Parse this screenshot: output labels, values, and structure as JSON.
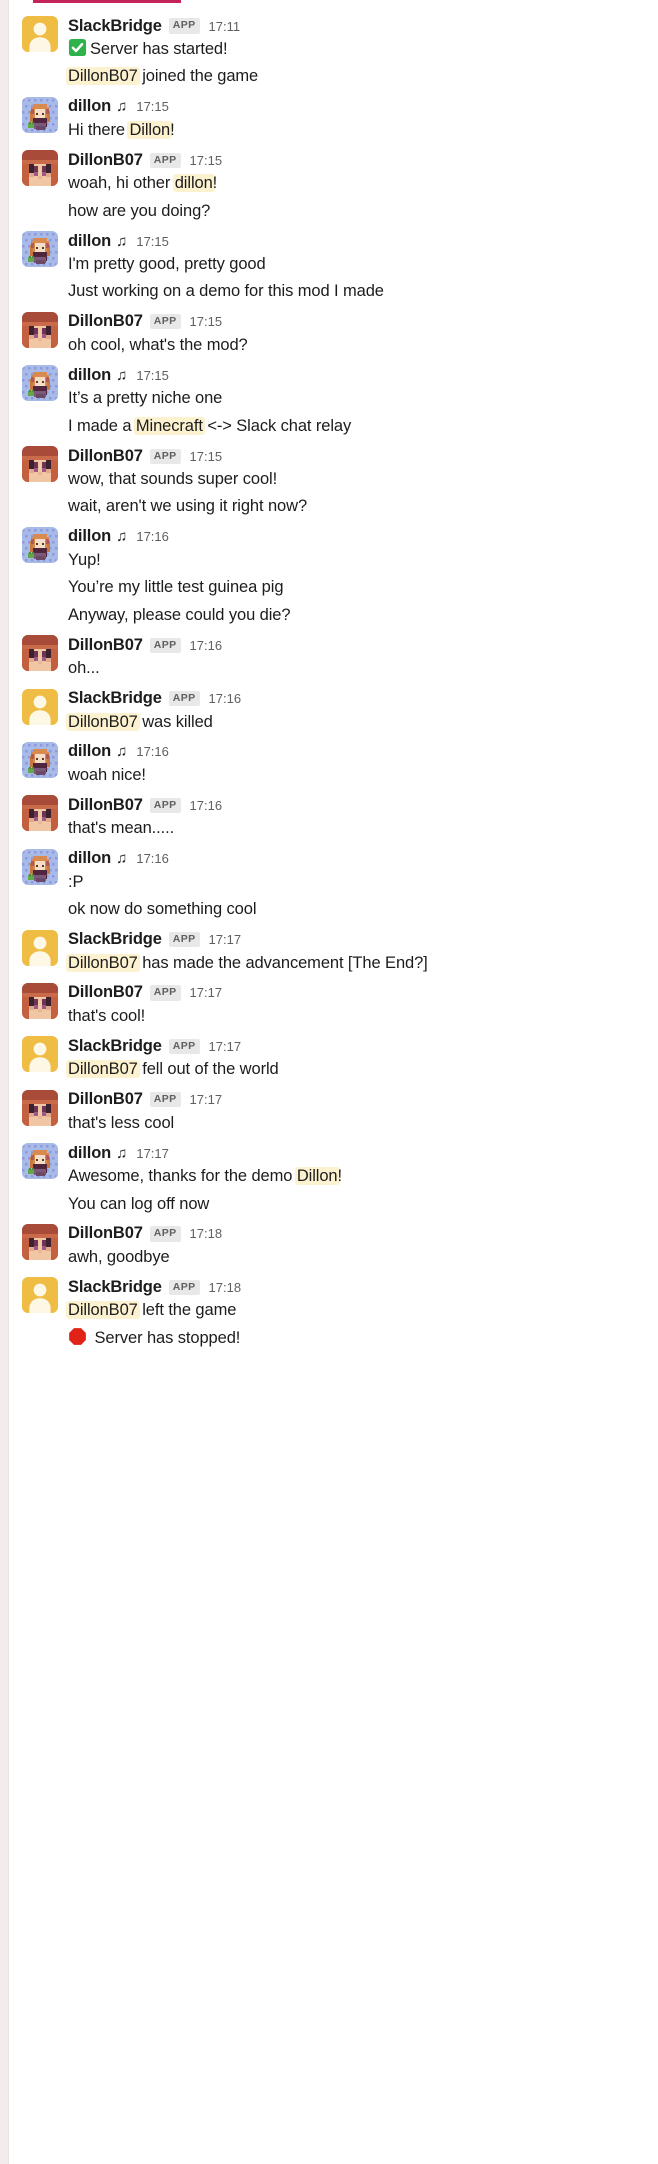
{
  "accent_color": "#c4235c",
  "mention_highlight_color": "#fdf2d0",
  "app_badge_label": "APP",
  "users": {
    "slackbridge": {
      "name": "SlackBridge",
      "is_app": true,
      "avatar": "yellow-person-avatar"
    },
    "dillon": {
      "name": "dillon",
      "is_app": false,
      "status_emoji": "musical-note",
      "avatar": "pixel-girl-avatar"
    },
    "dillonb07": {
      "name": "DillonB07",
      "is_app": true,
      "avatar": "minecraft-skin-avatar"
    }
  },
  "messages": [
    {
      "user": "slackbridge",
      "name": "SlackBridge",
      "badge": "APP",
      "time": "17:11",
      "first": true,
      "lines": [
        {
          "emoji": "white-check-mark",
          "text": "Server has started!"
        },
        {
          "mention": "DillonB07",
          "text": " joined the game"
        }
      ]
    },
    {
      "user": "dillon",
      "name": "dillon",
      "badge": "",
      "time": "17:15",
      "first": true,
      "lines": [
        {
          "text": "Hi there ",
          "mention_after": "Dillon",
          "text_after": "!"
        }
      ]
    },
    {
      "user": "dillonb07",
      "name": "DillonB07",
      "badge": "APP",
      "time": "17:15",
      "first": true,
      "lines": [
        {
          "text": "woah, hi other ",
          "mention_after": "dillon",
          "text_after": "!"
        },
        {
          "text": "how are you doing?"
        }
      ]
    },
    {
      "user": "dillon",
      "name": "dillon",
      "badge": "",
      "time": "17:15",
      "first": true,
      "lines": [
        {
          "text": "I'm pretty good, pretty good"
        },
        {
          "text": "Just working on a demo for this mod I made"
        }
      ]
    },
    {
      "user": "dillonb07",
      "name": "DillonB07",
      "badge": "APP",
      "time": "17:15",
      "first": true,
      "lines": [
        {
          "text": "oh cool, what's the mod?"
        }
      ]
    },
    {
      "user": "dillon",
      "name": "dillon",
      "badge": "",
      "time": "17:15",
      "first": true,
      "lines": [
        {
          "text": "It’s a pretty niche one"
        },
        {
          "text": "I made a ",
          "mention_after": "Minecraft",
          "text_after": " <-> Slack chat relay"
        }
      ]
    },
    {
      "user": "dillonb07",
      "name": "DillonB07",
      "badge": "APP",
      "time": "17:15",
      "first": true,
      "lines": [
        {
          "text": "wow, that sounds super cool!"
        },
        {
          "text": "wait, aren't we using it right now?"
        }
      ]
    },
    {
      "user": "dillon",
      "name": "dillon",
      "badge": "",
      "time": "17:16",
      "first": true,
      "lines": [
        {
          "text": "Yup!"
        },
        {
          "text": "You’re my little test guinea pig"
        },
        {
          "text": "Anyway, please could you die?"
        }
      ]
    },
    {
      "user": "dillonb07",
      "name": "DillonB07",
      "badge": "APP",
      "time": "17:16",
      "first": true,
      "lines": [
        {
          "text": "oh..."
        }
      ]
    },
    {
      "user": "slackbridge",
      "name": "SlackBridge",
      "badge": "APP",
      "time": "17:16",
      "first": true,
      "lines": [
        {
          "mention": "DillonB07",
          "text": " was killed"
        }
      ]
    },
    {
      "user": "dillon",
      "name": "dillon",
      "badge": "",
      "time": "17:16",
      "first": true,
      "lines": [
        {
          "text": "woah nice!"
        }
      ]
    },
    {
      "user": "dillonb07",
      "name": "DillonB07",
      "badge": "APP",
      "time": "17:16",
      "first": true,
      "lines": [
        {
          "text": "that's mean....."
        }
      ]
    },
    {
      "user": "dillon",
      "name": "dillon",
      "badge": "",
      "time": "17:16",
      "first": true,
      "lines": [
        {
          "text": ":P"
        },
        {
          "text": "ok now do something cool"
        }
      ]
    },
    {
      "user": "slackbridge",
      "name": "SlackBridge",
      "badge": "APP",
      "time": "17:17",
      "first": true,
      "lines": [
        {
          "mention": "DillonB07",
          "text": " has made the advancement [The End?]"
        }
      ]
    },
    {
      "user": "dillonb07",
      "name": "DillonB07",
      "badge": "APP",
      "time": "17:17",
      "first": true,
      "lines": [
        {
          "text": "that's cool!"
        }
      ]
    },
    {
      "user": "slackbridge",
      "name": "SlackBridge",
      "badge": "APP",
      "time": "17:17",
      "first": true,
      "lines": [
        {
          "mention": "DillonB07",
          "text": " fell out of the world"
        }
      ]
    },
    {
      "user": "dillonb07",
      "name": "DillonB07",
      "badge": "APP",
      "time": "17:17",
      "first": true,
      "lines": [
        {
          "text": "that's less cool"
        }
      ]
    },
    {
      "user": "dillon",
      "name": "dillon",
      "badge": "",
      "time": "17:17",
      "first": true,
      "lines": [
        {
          "text": "Awesome, thanks for the demo ",
          "mention_after": "Dillon",
          "text_after": "!"
        },
        {
          "text": "You can log off now"
        }
      ]
    },
    {
      "user": "dillonb07",
      "name": "DillonB07",
      "badge": "APP",
      "time": "17:18",
      "first": true,
      "lines": [
        {
          "text": "awh, goodbye"
        }
      ]
    },
    {
      "user": "slackbridge",
      "name": "SlackBridge",
      "badge": "APP",
      "time": "17:18",
      "first": true,
      "lines": [
        {
          "mention": "DillonB07",
          "text": " left the game"
        },
        {
          "emoji": "octagonal-sign",
          "text": " Server has stopped!"
        }
      ]
    }
  ]
}
